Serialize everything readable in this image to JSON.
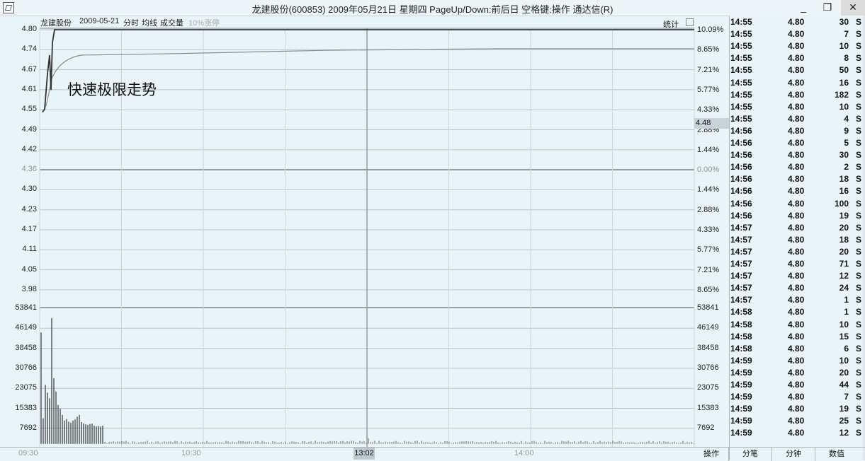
{
  "window": {
    "title": "龙建股份(600853) 2009年05月21日 星期四 PageUp/Down:前后日 空格键:操作 通达信(R)",
    "buttons": [
      "_",
      "❐",
      "✕"
    ]
  },
  "header": {
    "stock_name": "龙建股份",
    "date": "2009-05-21",
    "mode": "分时",
    "avg_label": "均线",
    "volume_label": "成交量",
    "limit_label": "10%涨停",
    "stat_label": "统计"
  },
  "annotation": "快速极限走势",
  "price_axis": {
    "left": [
      "4.80",
      "4.74",
      "4.67",
      "4.61",
      "4.55",
      "4.49",
      "4.42",
      "4.36",
      "4.30",
      "4.23",
      "4.17",
      "4.11",
      "4.05",
      "3.98"
    ],
    "right": [
      "10.09%",
      "8.65%",
      "7.21%",
      "5.77%",
      "4.33%",
      "2.88%",
      "1.44%",
      "0.00%",
      "1.44%",
      "2.88%",
      "4.33%",
      "5.77%",
      "7.21%",
      "8.65%"
    ],
    "current_tick": "4.48"
  },
  "volume_axis": {
    "labels": [
      "53841",
      "46149",
      "38458",
      "30766",
      "23075",
      "15383",
      "7692"
    ]
  },
  "time_axis": {
    "labels": [
      "09:30",
      "10:30",
      "14:00"
    ],
    "cursor": "13:02"
  },
  "trades": [
    {
      "time": "14:55",
      "price": "4.80",
      "vol": "30",
      "side": "S"
    },
    {
      "time": "14:55",
      "price": "4.80",
      "vol": "7",
      "side": "S"
    },
    {
      "time": "14:55",
      "price": "4.80",
      "vol": "10",
      "side": "S"
    },
    {
      "time": "14:55",
      "price": "4.80",
      "vol": "8",
      "side": "S"
    },
    {
      "time": "14:55",
      "price": "4.80",
      "vol": "50",
      "side": "S"
    },
    {
      "time": "14:55",
      "price": "4.80",
      "vol": "16",
      "side": "S"
    },
    {
      "time": "14:55",
      "price": "4.80",
      "vol": "182",
      "side": "S"
    },
    {
      "time": "14:55",
      "price": "4.80",
      "vol": "10",
      "side": "S"
    },
    {
      "time": "14:55",
      "price": "4.80",
      "vol": "4",
      "side": "S"
    },
    {
      "time": "14:56",
      "price": "4.80",
      "vol": "9",
      "side": "S"
    },
    {
      "time": "14:56",
      "price": "4.80",
      "vol": "5",
      "side": "S"
    },
    {
      "time": "14:56",
      "price": "4.80",
      "vol": "30",
      "side": "S"
    },
    {
      "time": "14:56",
      "price": "4.80",
      "vol": "2",
      "side": "S"
    },
    {
      "time": "14:56",
      "price": "4.80",
      "vol": "18",
      "side": "S"
    },
    {
      "time": "14:56",
      "price": "4.80",
      "vol": "16",
      "side": "S"
    },
    {
      "time": "14:56",
      "price": "4.80",
      "vol": "100",
      "side": "S"
    },
    {
      "time": "14:56",
      "price": "4.80",
      "vol": "19",
      "side": "S"
    },
    {
      "time": "14:57",
      "price": "4.80",
      "vol": "20",
      "side": "S"
    },
    {
      "time": "14:57",
      "price": "4.80",
      "vol": "18",
      "side": "S"
    },
    {
      "time": "14:57",
      "price": "4.80",
      "vol": "20",
      "side": "S"
    },
    {
      "time": "14:57",
      "price": "4.80",
      "vol": "71",
      "side": "S"
    },
    {
      "time": "14:57",
      "price": "4.80",
      "vol": "12",
      "side": "S"
    },
    {
      "time": "14:57",
      "price": "4.80",
      "vol": "24",
      "side": "S"
    },
    {
      "time": "14:57",
      "price": "4.80",
      "vol": "1",
      "side": "S"
    },
    {
      "time": "14:58",
      "price": "4.80",
      "vol": "1",
      "side": "S"
    },
    {
      "time": "14:58",
      "price": "4.80",
      "vol": "10",
      "side": "S"
    },
    {
      "time": "14:58",
      "price": "4.80",
      "vol": "15",
      "side": "S"
    },
    {
      "time": "14:58",
      "price": "4.80",
      "vol": "6",
      "side": "S"
    },
    {
      "time": "14:59",
      "price": "4.80",
      "vol": "10",
      "side": "S"
    },
    {
      "time": "14:59",
      "price": "4.80",
      "vol": "20",
      "side": "S"
    },
    {
      "time": "14:59",
      "price": "4.80",
      "vol": "44",
      "side": "S"
    },
    {
      "time": "14:59",
      "price": "4.80",
      "vol": "7",
      "side": "S"
    },
    {
      "time": "14:59",
      "price": "4.80",
      "vol": "19",
      "side": "S"
    },
    {
      "time": "14:59",
      "price": "4.80",
      "vol": "25",
      "side": "S"
    },
    {
      "time": "14:59",
      "price": "4.80",
      "vol": "12",
      "side": "S"
    }
  ],
  "tabs": [
    "操作",
    "分笔",
    "分钟",
    "数值"
  ],
  "colors": {
    "background": "#e9f4f8",
    "grid": "#9aa4a8",
    "price_line": "#333333",
    "avg_line": "#8a8a8a"
  }
}
